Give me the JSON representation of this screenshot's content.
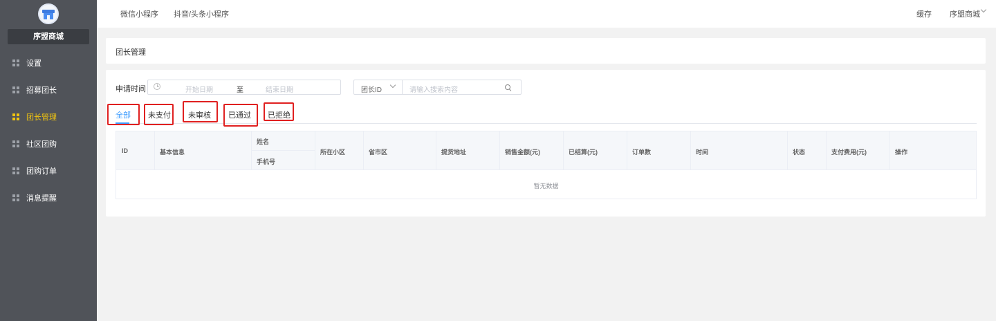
{
  "sidebar": {
    "shop_name": "序盟商城",
    "items": [
      {
        "label": "设置",
        "active": false
      },
      {
        "label": "招募团长",
        "active": false
      },
      {
        "label": "团长管理",
        "active": true
      },
      {
        "label": "社区团购",
        "active": false
      },
      {
        "label": "团购订单",
        "active": false
      },
      {
        "label": "消息提醒",
        "active": false
      }
    ]
  },
  "topbar": {
    "tabs": [
      "微信小程序",
      "抖音/头条小程序"
    ],
    "cache_label": "缓存",
    "user_menu_label": "序盟商城"
  },
  "page": {
    "title": "团长管理"
  },
  "filters": {
    "date_label": "申请时间",
    "start_placeholder": "开始日期",
    "range_separator": "至",
    "end_placeholder": "结束日期",
    "search_field_selected": "团长ID",
    "search_placeholder": "请输入搜索内容"
  },
  "status_tabs": [
    {
      "label": "全部",
      "active": true
    },
    {
      "label": "未支付",
      "active": false
    },
    {
      "label": "未审核",
      "active": false
    },
    {
      "label": "已通过",
      "active": false
    },
    {
      "label": "已拒绝",
      "active": false
    }
  ],
  "table": {
    "columns": {
      "id": "ID",
      "basic_info": "基本信息",
      "name": "姓名",
      "phone": "手机号",
      "community": "所在小区",
      "region": "省市区",
      "pickup_address": "提货地址",
      "sales_amount": "销售金额(元)",
      "settled": "已结算(元)",
      "order_count": "订单数",
      "time": "时间",
      "status": "状态",
      "paid_fee": "支付费用(元)",
      "actions": "操作"
    },
    "empty_text": "暂无数据"
  },
  "colors": {
    "sidebar_bg": "#505359",
    "active_nav": "#f1c40f",
    "accent": "#409eff",
    "highlight_box": "#e02020"
  }
}
